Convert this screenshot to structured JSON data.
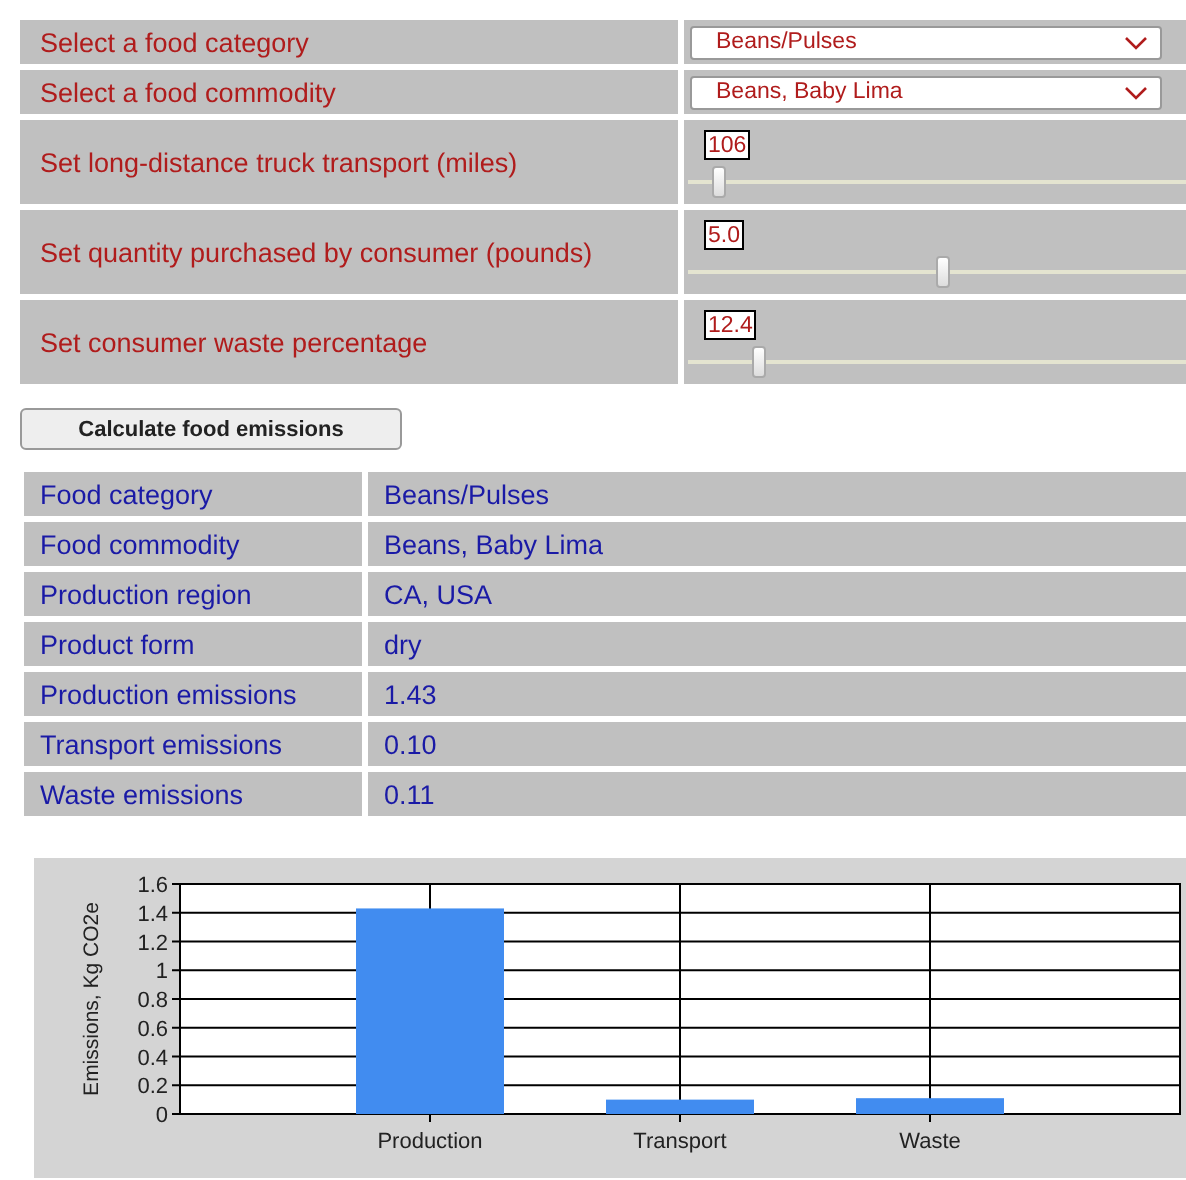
{
  "selectors": [
    {
      "label": "Select a food category",
      "value": "Beans/Pulses"
    },
    {
      "label": "Select a food commodity",
      "value": "Beans, Baby Lima"
    }
  ],
  "sliders": [
    {
      "label": "Set long-distance truck transport (miles)",
      "reading": "106",
      "level": 0.06
    },
    {
      "label": "Set quantity purchased by consumer (pounds)",
      "reading": "5.0",
      "level": 0.51
    },
    {
      "label": "Set consumer waste percentage",
      "reading": "12.4",
      "level": 0.14
    }
  ],
  "calculate_button": "Calculate food emissions",
  "results": [
    {
      "label": "Food category",
      "value": "Beans/Pulses"
    },
    {
      "label": "Food commodity",
      "value": "Beans, Baby Lima"
    },
    {
      "label": "Production region",
      "value": "CA, USA"
    },
    {
      "label": "Product form",
      "value": "dry"
    },
    {
      "label": "Production emissions",
      "value": "1.43"
    },
    {
      "label": "Transport emissions",
      "value": "0.10"
    },
    {
      "label": "Waste emissions",
      "value": "0.11"
    }
  ],
  "chart": {
    "chart_data": {
      "type": "bar",
      "ylabel": "Emissions, Kg CO2e",
      "categories": [
        "Production",
        "Transport",
        "Waste"
      ],
      "series": [
        {
          "color": "#418cf0",
          "values": [
            1.43,
            0.1,
            0.11
          ]
        }
      ],
      "grid": true,
      "ylim": [
        0,
        1.6
      ],
      "yticks": [
        0,
        0.2,
        0.4,
        0.6,
        0.8,
        {
          "value": 1,
          "label": "1"
        },
        1.2,
        1.4,
        1.6
      ]
    }
  }
}
